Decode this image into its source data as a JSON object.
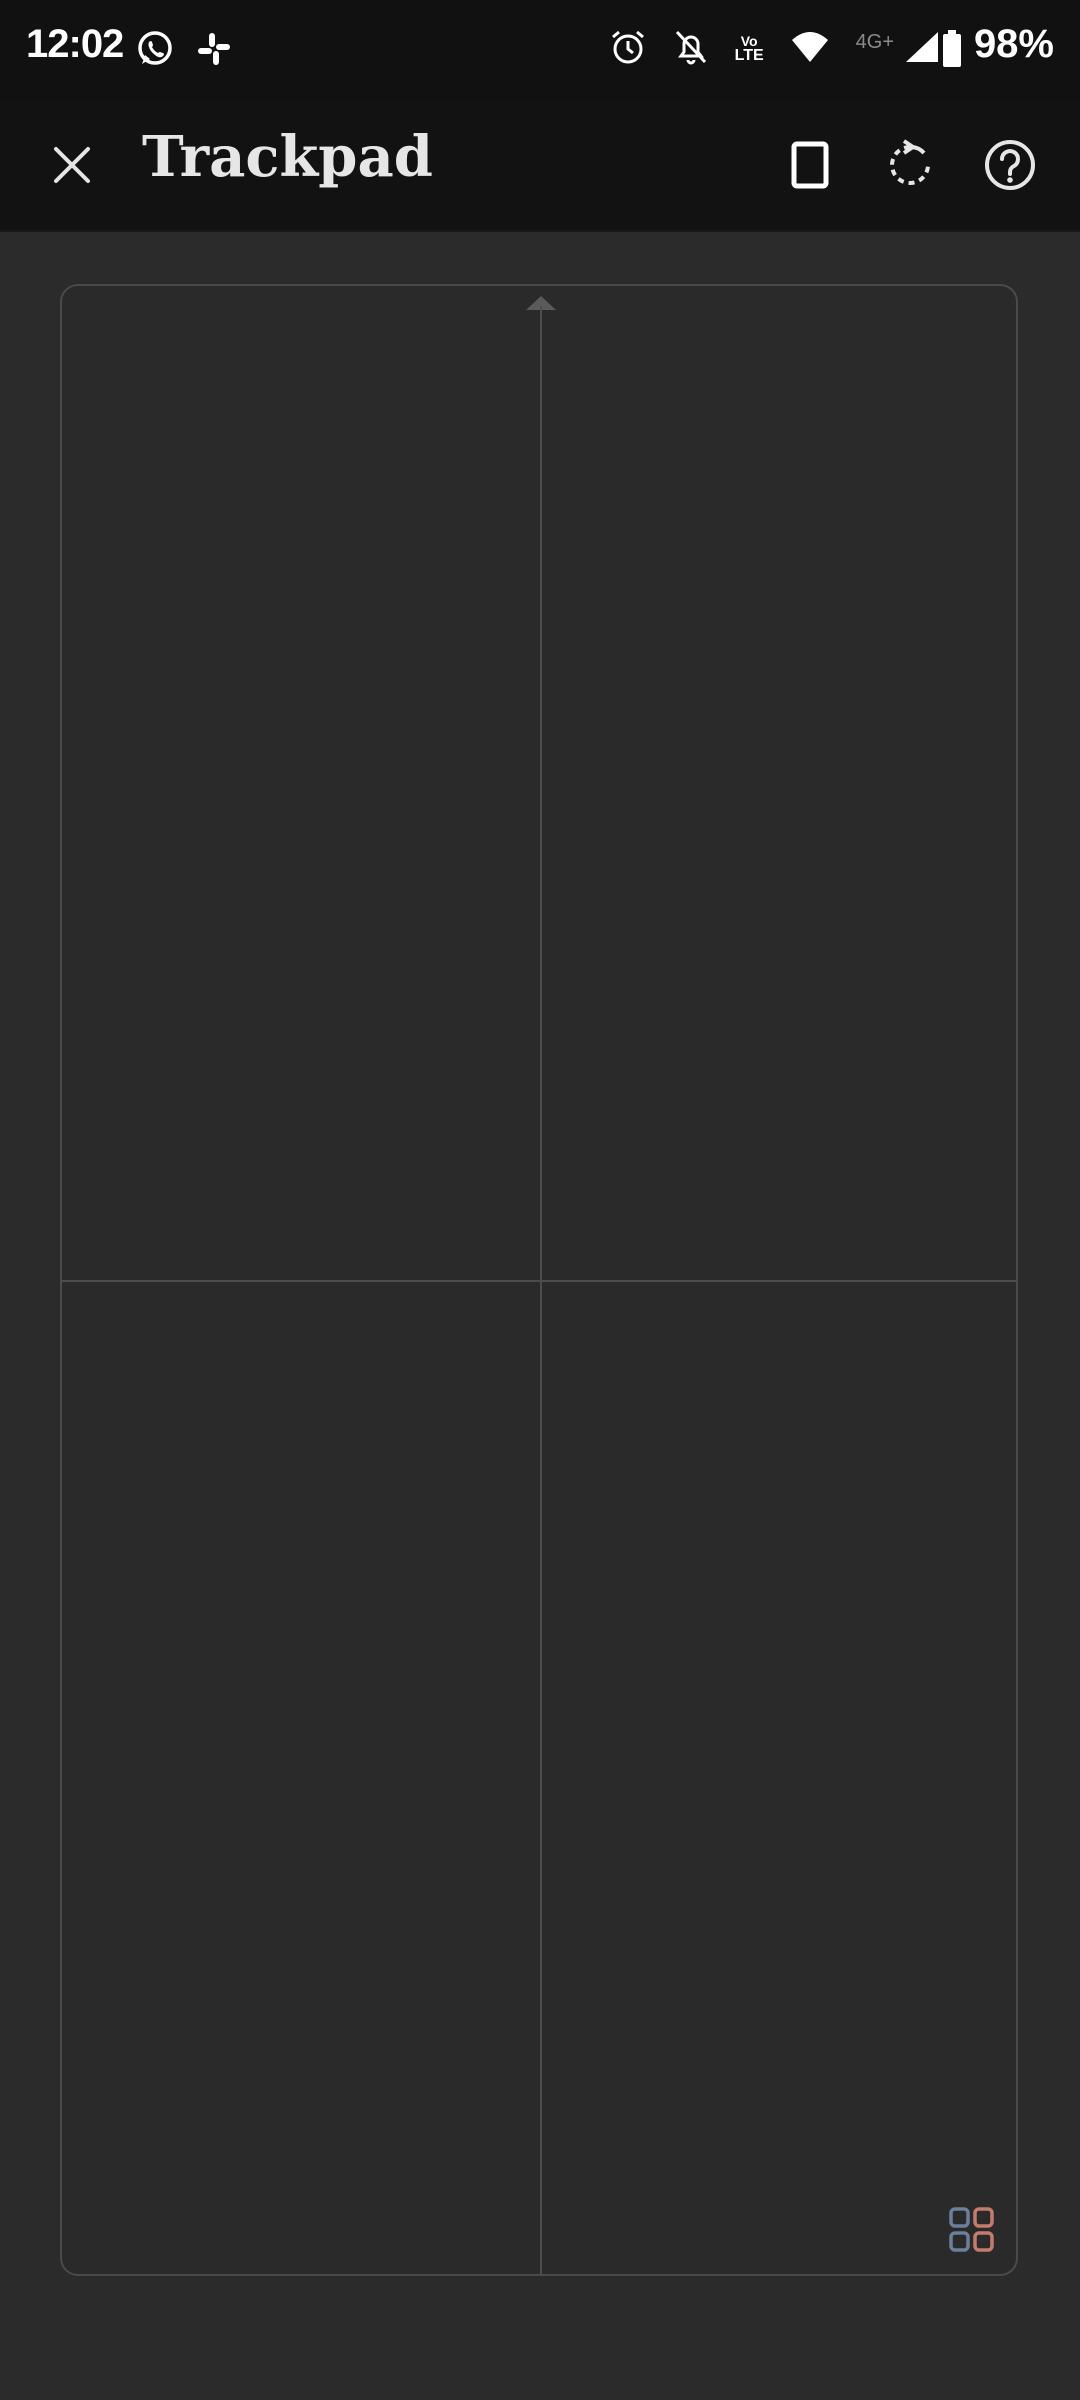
{
  "status_bar": {
    "time": "12:02",
    "battery": "98%",
    "network": "4G+",
    "volte_top": "Vo",
    "volte_bottom": "LTE"
  },
  "toolbar": {
    "title": "Trackpad",
    "close_icon": "close-icon",
    "screen_icon": "phone-frame-icon",
    "rotate_icon": "rotate-icon",
    "help_icon": "help-icon"
  },
  "pad": {
    "grid_icon": "grid-icon",
    "grid_colors": [
      "#6b7f9a",
      "#c47a6c",
      "#6b7f9a",
      "#c47a6c"
    ]
  }
}
